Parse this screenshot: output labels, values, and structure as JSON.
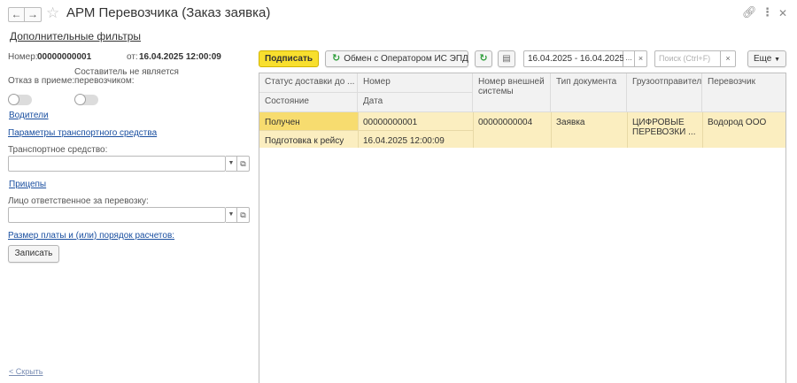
{
  "window": {
    "title": "АРМ Перевозчика (Заказ заявка)",
    "back_icon": "arrow-left",
    "forward_icon": "arrow-right",
    "favorite_icon": "star",
    "link_icon": "link",
    "more_icon": "vertical-dots",
    "close_icon": "close"
  },
  "extra_filters_label": "Дополнительные фильтры",
  "left_panel": {
    "number_label": "Номер:",
    "number_value": "00000000001",
    "date_label": "от:",
    "date_value": "16.04.2025 12:00:09",
    "refusal_label": "Отказ в приеме:",
    "refusal_on": false,
    "compiler_label": "Составитель не является перевозчиком:",
    "compiler_on": false,
    "drivers_link": "Водители",
    "vehicle_params_link": "Параметры транспортного средства",
    "vehicle_label": "Транспортное средство:",
    "vehicle_value": "",
    "trailers_link": "Прицепы",
    "responsible_label": "Лицо ответственное за перевозку:",
    "responsible_value": "",
    "payment_link": "Размер платы и (или) порядок расчетов:",
    "save_button": "Записать",
    "hide_link": "< Скрыть"
  },
  "toolbar": {
    "sign_button": "Подписать",
    "exchange_button": "Обмен с Оператором ИС ЭПД",
    "period_value": "16.04.2025 - 16.04.2025",
    "period_select": "...",
    "clear_symbol": "×",
    "search_placeholder": "Поиск (Ctrl+F)",
    "more_button": "Еще",
    "accent_color": "#f8df2e"
  },
  "table": {
    "headers_row1": [
      "Статус доставки до ...",
      "Номер",
      "Номер внешней системы",
      "Тип документа",
      "Грузоотправитель",
      "Перевозчик"
    ],
    "headers_row2": [
      "Состояние",
      "Дата"
    ],
    "rows": [
      {
        "status": "Получен",
        "state": "Подготовка к рейсу",
        "number": "00000000001",
        "date": "16.04.2025 12:00:09",
        "external_number": "00000000004",
        "doc_type": "Заявка",
        "shipper": "ЦИФРОВЫЕ ПЕРЕВОЗКИ ...",
        "carrier": "Водород ООО"
      }
    ],
    "selected_row_color": "#fbeec0"
  }
}
